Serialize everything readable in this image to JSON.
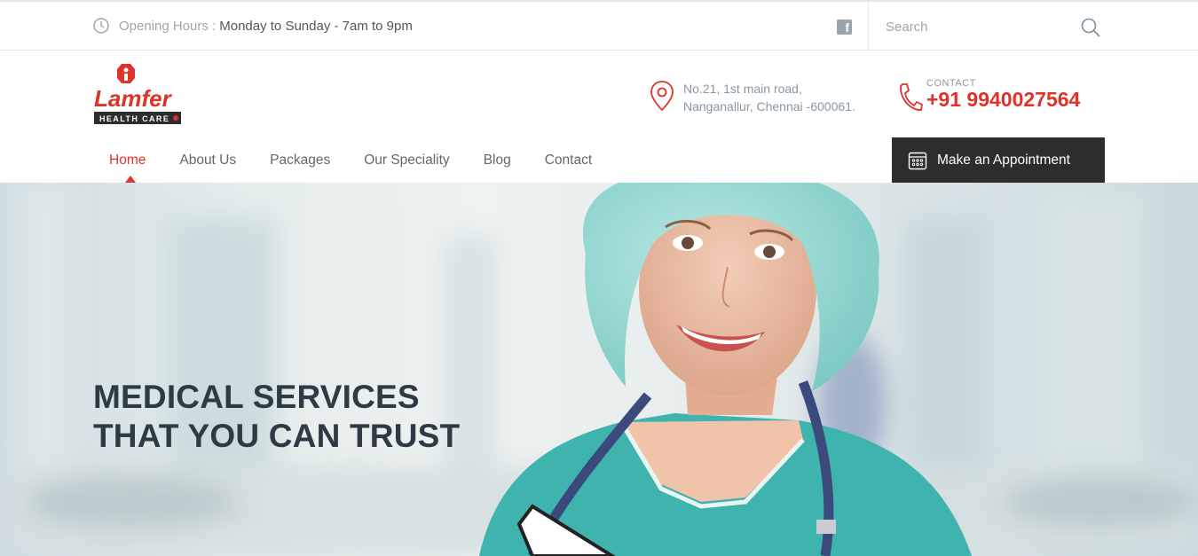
{
  "topbar": {
    "hours_label": "Opening Hours :",
    "hours_value": "Monday to Sunday - 7am to 9pm",
    "social": "f",
    "search_placeholder": "Search"
  },
  "brand": {
    "name": "Lamfer",
    "tagline": "HEALTH CARE"
  },
  "address": {
    "line1": "No.21, 1st main road,",
    "line2": "Nanganallur, Chennai -600061."
  },
  "contact": {
    "label": "CONTACT",
    "phone": "+91 9940027564"
  },
  "nav": {
    "items": [
      "Home",
      "About Us",
      "Packages",
      "Our Speciality",
      "Blog",
      "Contact"
    ],
    "active": "Home"
  },
  "cta": {
    "label": "Make an Appointment"
  },
  "hero": {
    "line1": "MEDICAL SERVICES",
    "line2": "THAT YOU CAN TRUST"
  },
  "colors": {
    "accent": "#e0312a",
    "dark": "#2d2d2d",
    "heading": "#2e3a44",
    "scrubs": "#3fb3ad"
  }
}
